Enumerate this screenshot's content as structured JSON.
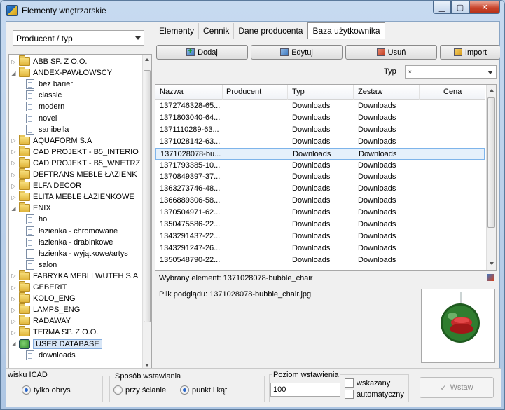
{
  "window": {
    "title": "Elementy wnętrzarskie"
  },
  "left": {
    "filter_value": "Producent / typ",
    "tree": [
      {
        "label": "ABB SP. Z O.O.",
        "kind": "folder",
        "expander": "▷",
        "indent": 0
      },
      {
        "label": "ANDEX-PAWŁOWSCY",
        "kind": "folder",
        "expander": "◢",
        "indent": 0
      },
      {
        "label": "bez barier",
        "kind": "doc",
        "expander": "",
        "indent": 1
      },
      {
        "label": "classic",
        "kind": "doc",
        "expander": "",
        "indent": 1
      },
      {
        "label": "modern",
        "kind": "doc",
        "expander": "",
        "indent": 1
      },
      {
        "label": "novel",
        "kind": "doc",
        "expander": "",
        "indent": 1
      },
      {
        "label": "sanibella",
        "kind": "doc",
        "expander": "",
        "indent": 1
      },
      {
        "label": "AQUAFORM S.A",
        "kind": "folder",
        "expander": "▷",
        "indent": 0
      },
      {
        "label": "CAD PROJEKT - B5_INTERIO",
        "kind": "folder",
        "expander": "▷",
        "indent": 0
      },
      {
        "label": "CAD PROJEKT - B5_WNETRZ",
        "kind": "folder",
        "expander": "▷",
        "indent": 0
      },
      {
        "label": "DEFTRANS MEBLE ŁAZIENK",
        "kind": "folder",
        "expander": "▷",
        "indent": 0
      },
      {
        "label": "ELFA DECOR",
        "kind": "folder",
        "expander": "▷",
        "indent": 0
      },
      {
        "label": "ELITA MEBLE ŁAZIENKOWE",
        "kind": "folder",
        "expander": "▷",
        "indent": 0
      },
      {
        "label": "ENIX",
        "kind": "folder",
        "expander": "◢",
        "indent": 0
      },
      {
        "label": "hol",
        "kind": "doc",
        "expander": "",
        "indent": 1
      },
      {
        "label": "łazienka - chromowane",
        "kind": "doc",
        "expander": "",
        "indent": 1
      },
      {
        "label": "łazienka - drabinkowe",
        "kind": "doc",
        "expander": "",
        "indent": 1
      },
      {
        "label": "łazienka - wyjątkowe/artys",
        "kind": "doc",
        "expander": "",
        "indent": 1
      },
      {
        "label": "salon",
        "kind": "doc",
        "expander": "",
        "indent": 1
      },
      {
        "label": "FABRYKA MEBLI WUTEH S.A",
        "kind": "folder",
        "expander": "▷",
        "indent": 0
      },
      {
        "label": "GEBERIT",
        "kind": "folder",
        "expander": "▷",
        "indent": 0
      },
      {
        "label": "KOLO_ENG",
        "kind": "folder",
        "expander": "▷",
        "indent": 0
      },
      {
        "label": "LAMPS_ENG",
        "kind": "folder",
        "expander": "▷",
        "indent": 0
      },
      {
        "label": "RADAWAY",
        "kind": "folder",
        "expander": "▷",
        "indent": 0
      },
      {
        "label": "TERMA SP. Z O.O.",
        "kind": "folder",
        "expander": "▷",
        "indent": 0
      },
      {
        "label": "USER DATABASE",
        "kind": "db",
        "expander": "◢",
        "indent": 0,
        "selected": true
      },
      {
        "label": "downloads",
        "kind": "doc",
        "expander": "",
        "indent": 1
      }
    ]
  },
  "tabs": [
    "Elementy",
    "Cennik",
    "Dane producenta",
    "Baza użytkownika"
  ],
  "toolbar": {
    "add": "Dodaj",
    "edit": "Edytuj",
    "delete": "Usuń",
    "import": "Import"
  },
  "type_filter": {
    "label": "Typ",
    "value": "*"
  },
  "grid": {
    "columns": [
      "Nazwa",
      "Producent",
      "Typ",
      "Zestaw",
      "Cena"
    ],
    "rows": [
      [
        "1372746328-65...",
        "",
        "Downloads",
        "Downloads",
        ""
      ],
      [
        "1371803040-64...",
        "",
        "Downloads",
        "Downloads",
        ""
      ],
      [
        "1371110289-63...",
        "",
        "Downloads",
        "Downloads",
        ""
      ],
      [
        "1371028142-63...",
        "",
        "Downloads",
        "Downloads",
        ""
      ],
      [
        "1371028078-bu...",
        "",
        "Downloads",
        "Downloads",
        ""
      ],
      [
        "1371793385-10...",
        "",
        "Downloads",
        "Downloads",
        ""
      ],
      [
        "1370849397-37...",
        "",
        "Downloads",
        "Downloads",
        ""
      ],
      [
        "1363273746-48...",
        "",
        "Downloads",
        "Downloads",
        ""
      ],
      [
        "1366889306-58...",
        "",
        "Downloads",
        "Downloads",
        ""
      ],
      [
        "1370504971-62...",
        "",
        "Downloads",
        "Downloads",
        ""
      ],
      [
        "1350475586-22...",
        "",
        "Downloads",
        "Downloads",
        ""
      ],
      [
        "1343291437-22...",
        "",
        "Downloads",
        "Downloads",
        ""
      ],
      [
        "1343291247-26...",
        "",
        "Downloads",
        "Downloads",
        ""
      ],
      [
        "1350548790-22...",
        "",
        "Downloads",
        "Downloads",
        ""
      ]
    ],
    "selected_row": 4
  },
  "info": {
    "selected": "Wybrany element: 1371028078-bubble_chair",
    "preview_file": "Plik podglądu: 1371028078-bubble_chair.jpg"
  },
  "bottom": {
    "mode_title": "wisku ICAD",
    "mode_option": "tylko obrys",
    "insert_title": "Sposób wstawiania",
    "insert_opt1": "przy ścianie",
    "insert_opt2": "punkt i kąt",
    "level_title": "Poziom wstawienia",
    "level_value": "100",
    "chk1": "wskazany",
    "chk2": "automatyczny",
    "insert_button": "Wstaw"
  }
}
